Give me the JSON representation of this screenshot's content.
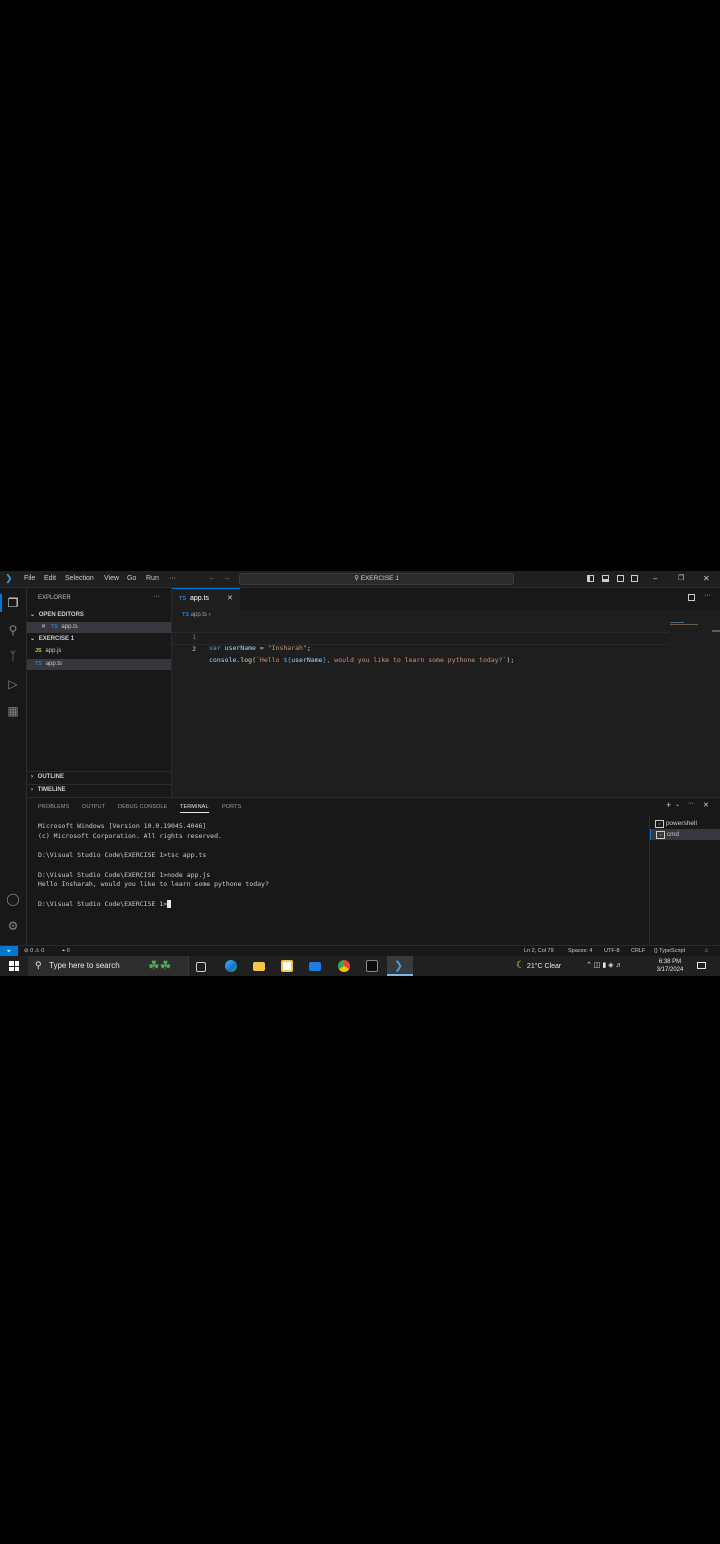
{
  "titlebar": {
    "menu": [
      "File",
      "Edit",
      "Selection",
      "View",
      "Go",
      "Run",
      "···"
    ],
    "search_text": "EXERCISE 1"
  },
  "sidebar": {
    "title": "EXPLORER",
    "more": "···",
    "open_editors_label": "OPEN EDITORS",
    "open_editor_file": "app.ts",
    "folder_label": "EXERCISE 1",
    "files": [
      "app.js",
      "app.ts"
    ],
    "outline_label": "OUTLINE",
    "timeline_label": "TIMELINE"
  },
  "editor": {
    "tab_label": "app.ts",
    "tab_icon": "TS",
    "breadcrumb": "app.ts",
    "lines": [
      {
        "num": "1",
        "tokens": [
          [
            "kw",
            "var "
          ],
          [
            "var",
            "userName"
          ],
          [
            "plain",
            " = "
          ],
          [
            "str",
            "\"Insharah\""
          ],
          [
            "plain",
            ";"
          ]
        ]
      },
      {
        "num": "2",
        "tokens": [
          [
            "var",
            "console"
          ],
          [
            "plain",
            "."
          ],
          [
            "fn",
            "log"
          ],
          [
            "plain",
            "("
          ],
          [
            "str",
            "`Hello "
          ],
          [
            "kw",
            "${"
          ],
          [
            "var",
            "userName"
          ],
          [
            "kw",
            "}"
          ],
          [
            "str",
            ", would you like to learn some pythone today?`"
          ],
          [
            "plain",
            ");"
          ]
        ]
      }
    ]
  },
  "panel": {
    "tabs": [
      "PROBLEMS",
      "OUTPUT",
      "DEBUG CONSOLE",
      "TERMINAL",
      "PORTS"
    ],
    "active_tab": "TERMINAL",
    "terminal_lines": [
      "Microsoft Windows [Version 10.0.19045.4046]",
      "(c) Microsoft Corporation. All rights reserved.",
      "",
      "D:\\Visual Studio Code\\EXERCISE 1>tsc app.ts",
      "",
      "D:\\Visual Studio Code\\EXERCISE 1>node app.js",
      "Hello Insharah, would you like to learn some pythone today?",
      "",
      "D:\\Visual Studio Code\\EXERCISE 1>"
    ],
    "terminals": [
      "powershell",
      "cmd"
    ]
  },
  "statusbar": {
    "errors": "0",
    "warnings": "0",
    "ports": "0",
    "position": "Ln 2, Col 79",
    "spaces": "Spaces: 4",
    "encoding": "UTF-8",
    "eol": "CRLF",
    "language": "TypeScript"
  },
  "taskbar": {
    "search_placeholder": "Type here to search",
    "weather": "21°C  Clear",
    "time": "6:38 PM",
    "date": "3/17/2024"
  },
  "colors": {
    "accent": "#0078d4",
    "editor_bg": "#1e1e1e",
    "sidebar_bg": "#181818"
  }
}
